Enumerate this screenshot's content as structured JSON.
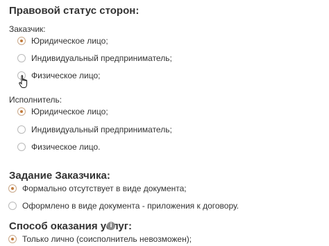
{
  "heading_parties": "Правовой статус сторон:",
  "customer": {
    "label": "Заказчик:",
    "options": [
      {
        "label": "Юридическое лицо;",
        "checked": true
      },
      {
        "label": "Индивидуальный предприниматель;",
        "checked": false
      },
      {
        "label": "Физическое лицо;",
        "checked": false
      }
    ]
  },
  "executor": {
    "label": "Исполнитель:",
    "options": [
      {
        "label": "Юридическое лицо;",
        "checked": true
      },
      {
        "label": "Индивидуальный предприниматель;",
        "checked": false
      },
      {
        "label": "Физическое лицо.",
        "checked": false
      }
    ]
  },
  "task": {
    "heading": "Задание Заказчика:",
    "options": [
      {
        "label": "Формально отсутствует в виде документа;",
        "checked": true
      },
      {
        "label": "Оформлено в виде документа - приложения к договору.",
        "checked": false
      }
    ]
  },
  "method": {
    "heading": "Способ оказания услуг:",
    "info_icon": "i",
    "options": [
      {
        "label": "Только лично (соисполнитель невозможен);",
        "checked": true
      }
    ]
  },
  "accent_color": "#c27a3a"
}
